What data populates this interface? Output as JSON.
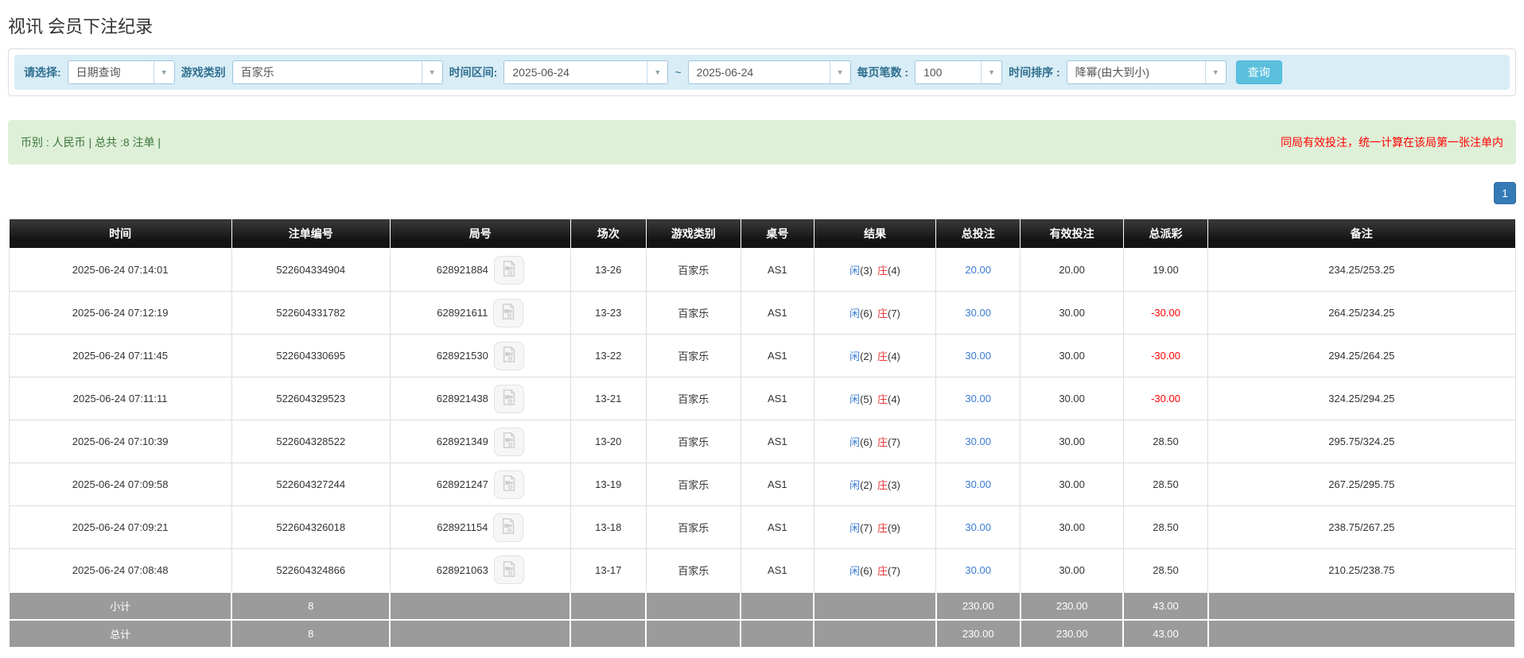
{
  "page_title": "视讯 会员下注纪录",
  "filters": {
    "select_label": "请选择:",
    "select_value": "日期查询",
    "game_type_label": "游戏类别",
    "game_type_value": "百家乐",
    "time_range_label": "时间区间:",
    "time_from": "2025-06-24",
    "tilde": "~",
    "time_to": "2025-06-24",
    "page_size_label": "每页笔数 :",
    "page_size_value": "100",
    "sort_label": "时间排序 :",
    "sort_value": "降幂(由大到小)",
    "search_button": "查询"
  },
  "summary": {
    "left": "币别 : 人民币 | 总共 :8 注单 |",
    "right": "同局有效投注，统一计算在该局第一张注单内"
  },
  "pagination": {
    "current": "1"
  },
  "table": {
    "headers": [
      "时间",
      "注单编号",
      "局号",
      "场次",
      "游戏类别",
      "桌号",
      "结果",
      "总投注",
      "有效投注",
      "总派彩",
      "备注"
    ],
    "col_widths": [
      "14.8%",
      "10.5%",
      "12%",
      "5%",
      "6.3%",
      "4.85%",
      "8.1%",
      "5.6%",
      "6.85%",
      "5.6%",
      "20.4%"
    ],
    "result_labels": {
      "player": "闲",
      "banker": "庄"
    },
    "rows": [
      {
        "time": "2025-06-24 07:14:01",
        "bet_id": "522604334904",
        "round_id": "628921884",
        "session": "13-26",
        "game": "百家乐",
        "table_no": "AS1",
        "player": "3",
        "banker": "4",
        "total_bet": "20.00",
        "valid_bet": "20.00",
        "payout": "19.00",
        "remark": "234.25/253.25"
      },
      {
        "time": "2025-06-24 07:12:19",
        "bet_id": "522604331782",
        "round_id": "628921611",
        "session": "13-23",
        "game": "百家乐",
        "table_no": "AS1",
        "player": "6",
        "banker": "7",
        "total_bet": "30.00",
        "valid_bet": "30.00",
        "payout": "-30.00",
        "remark": "264.25/234.25"
      },
      {
        "time": "2025-06-24 07:11:45",
        "bet_id": "522604330695",
        "round_id": "628921530",
        "session": "13-22",
        "game": "百家乐",
        "table_no": "AS1",
        "player": "2",
        "banker": "4",
        "total_bet": "30.00",
        "valid_bet": "30.00",
        "payout": "-30.00",
        "remark": "294.25/264.25"
      },
      {
        "time": "2025-06-24 07:11:11",
        "bet_id": "522604329523",
        "round_id": "628921438",
        "session": "13-21",
        "game": "百家乐",
        "table_no": "AS1",
        "player": "5",
        "banker": "4",
        "total_bet": "30.00",
        "valid_bet": "30.00",
        "payout": "-30.00",
        "remark": "324.25/294.25"
      },
      {
        "time": "2025-06-24 07:10:39",
        "bet_id": "522604328522",
        "round_id": "628921349",
        "session": "13-20",
        "game": "百家乐",
        "table_no": "AS1",
        "player": "6",
        "banker": "7",
        "total_bet": "30.00",
        "valid_bet": "30.00",
        "payout": "28.50",
        "remark": "295.75/324.25"
      },
      {
        "time": "2025-06-24 07:09:58",
        "bet_id": "522604327244",
        "round_id": "628921247",
        "session": "13-19",
        "game": "百家乐",
        "table_no": "AS1",
        "player": "2",
        "banker": "3",
        "total_bet": "30.00",
        "valid_bet": "30.00",
        "payout": "28.50",
        "remark": "267.25/295.75"
      },
      {
        "time": "2025-06-24 07:09:21",
        "bet_id": "522604326018",
        "round_id": "628921154",
        "session": "13-18",
        "game": "百家乐",
        "table_no": "AS1",
        "player": "7",
        "banker": "9",
        "total_bet": "30.00",
        "valid_bet": "30.00",
        "payout": "28.50",
        "remark": "238.75/267.25"
      },
      {
        "time": "2025-06-24 07:08:48",
        "bet_id": "522604324866",
        "round_id": "628921063",
        "session": "13-17",
        "game": "百家乐",
        "table_no": "AS1",
        "player": "6",
        "banker": "7",
        "total_bet": "30.00",
        "valid_bet": "30.00",
        "payout": "28.50",
        "remark": "210.25/238.75"
      }
    ],
    "footer": [
      {
        "label": "小计",
        "count": "8",
        "total_bet": "230.00",
        "valid_bet": "230.00",
        "payout": "43.00"
      },
      {
        "label": "总计",
        "count": "8",
        "total_bet": "230.00",
        "valid_bet": "230.00",
        "payout": "43.00"
      }
    ]
  },
  "colors": {
    "accent_blue": "#337ab7",
    "info_blue": "#5bc0de",
    "filter_bg": "#d9edf7",
    "summary_bg": "#dff0d8",
    "summary_text": "#3c763d",
    "notice_red": "#ff0000",
    "player_blue": "#3a7bd5",
    "banker_red": "#e4393c",
    "header_bg": "#1b1b1b",
    "footer_bg": "#9b9b9b"
  }
}
